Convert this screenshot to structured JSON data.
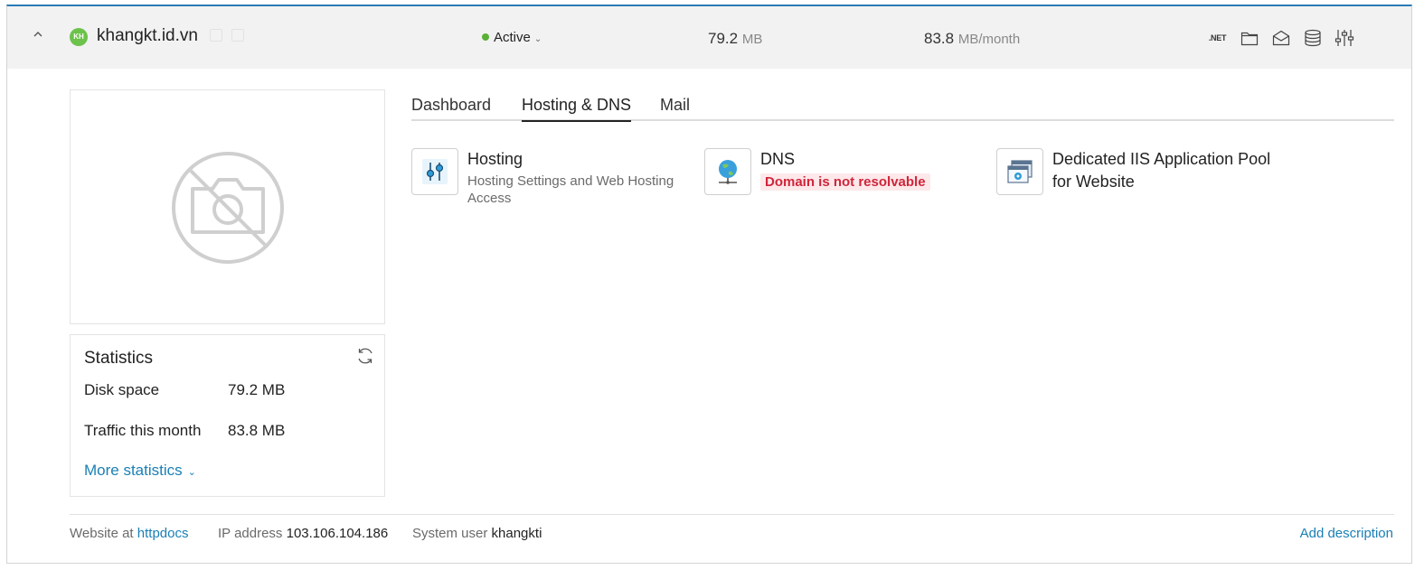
{
  "header": {
    "collapse_glyph": "^",
    "avatar_initials": "KH",
    "site_name": "khangkt.id.vn",
    "status": "Active",
    "disk": {
      "value": "79.2",
      "unit": "MB"
    },
    "traffic": {
      "value": "83.8",
      "unit": "MB/month"
    },
    "icons": [
      ".NET",
      "folder-icon",
      "mail-icon",
      "database-icon",
      "settings-sliders-icon"
    ],
    "net_label": ".NET",
    "status_color": "#5bb038"
  },
  "statistics": {
    "title": "Statistics",
    "rows": [
      {
        "label": "Disk space",
        "value": "79.2 MB"
      },
      {
        "label": "Traffic this month",
        "value": "83.8 MB"
      }
    ],
    "more_label": "More statistics"
  },
  "tabs": [
    {
      "label": "Dashboard",
      "active": false
    },
    {
      "label": "Hosting & DNS",
      "active": true
    },
    {
      "label": "Mail",
      "active": false
    }
  ],
  "tools": [
    {
      "title": "Hosting",
      "description": "Hosting Settings and Web Hosting Access",
      "icon": "sliders-icon"
    },
    {
      "title": "DNS",
      "warning": "Domain is not resolvable",
      "icon": "globe-network-icon"
    },
    {
      "title": "Dedicated IIS Application Pool for Website",
      "icon": "app-pool-icon"
    }
  ],
  "footer": {
    "website_label": "Website at",
    "website_link": "httpdocs",
    "ip_label": "IP address",
    "ip_value": "103.106.104.186",
    "user_label": "System user",
    "user_value": "khangkti",
    "add_description": "Add description"
  },
  "colors": {
    "accent": "#1a7fb5",
    "warning": "#d0253a",
    "active_tab": "#222222"
  }
}
